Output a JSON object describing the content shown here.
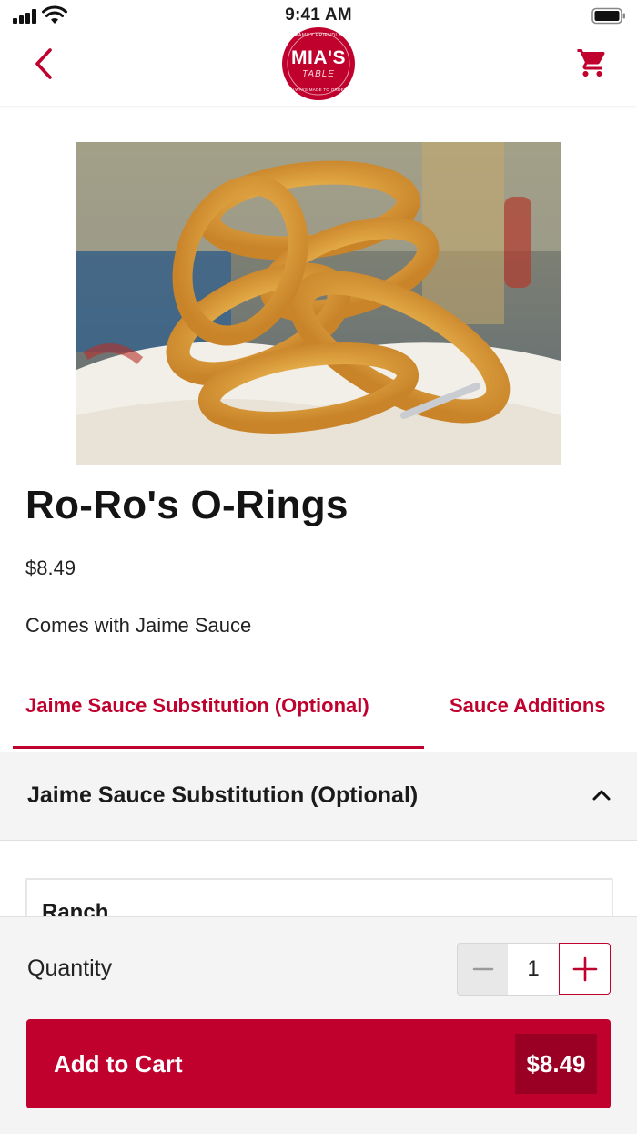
{
  "status_bar": {
    "time": "9:41 AM"
  },
  "header": {
    "back_icon": "chevron-left-icon",
    "logo": {
      "name": "MIA'S",
      "sub": "TABLE",
      "ring_top": "FAMILY FRIENDLY",
      "ring_bottom": "ALWAYS MADE TO ORDER"
    },
    "cart_icon": "shopping-cart-icon"
  },
  "product": {
    "image": "onion-rings-photo",
    "title": "Ro-Ro's O-Rings",
    "price": "$8.49",
    "description": "Comes with Jaime Sauce"
  },
  "tabs": [
    {
      "label": "Jaime Sauce Substitution (Optional)",
      "active": true
    },
    {
      "label": "Sauce Additions",
      "active": false
    }
  ],
  "accordion": {
    "title": "Jaime Sauce Substitution (Optional)",
    "expanded": true,
    "chevron_icon": "chevron-up-icon"
  },
  "options": [
    {
      "label": "Ranch"
    }
  ],
  "order": {
    "quantity_label": "Quantity",
    "quantity": "1",
    "minus_icon": "minus-icon",
    "plus_icon": "plus-icon",
    "add_label": "Add to Cart",
    "total": "$8.49"
  },
  "colors": {
    "brand": "#c0002d",
    "brand_dark": "#9a0024",
    "panel": "#f4f4f4"
  }
}
